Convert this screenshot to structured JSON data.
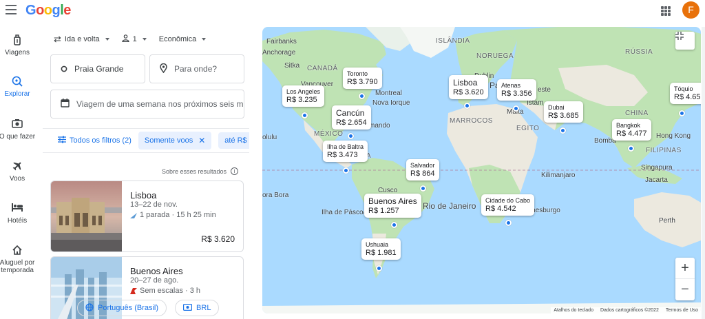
{
  "header": {
    "logo_letters": [
      "G",
      "o",
      "o",
      "g",
      "l",
      "e"
    ],
    "logo_colors": [
      "#4285f4",
      "#ea4335",
      "#fbbc05",
      "#4285f4",
      "#34a853",
      "#ea4335"
    ],
    "avatar_letter": "F"
  },
  "nav": [
    {
      "label": "Viagens",
      "icon": "suitcase-icon"
    },
    {
      "label": "Explorar",
      "icon": "explore-icon",
      "active": true
    },
    {
      "label": "O que fazer",
      "icon": "camera-icon"
    },
    {
      "label": "Voos",
      "icon": "plane-icon"
    },
    {
      "label": "Hotéis",
      "icon": "bed-icon"
    },
    {
      "label": "Aluguel por temporada",
      "icon": "house-icon"
    }
  ],
  "search": {
    "trip_type": "Ida e volta",
    "passengers": "1",
    "cabin": "Econômica",
    "origin": "Praia Grande",
    "destination_placeholder": "Para onde?",
    "dates": "Viagem de uma semana nos próximos seis m..."
  },
  "filters": {
    "all_filters": "Todos os filtros (2)",
    "chip_flights": "Somente voos",
    "chip_price": "até R$"
  },
  "results_note": "Sobre esses resultados",
  "results": [
    {
      "name": "Lisboa",
      "dates": "13–22 de nov.",
      "stops": "1 parada · 15 h 25 min",
      "price": "R$ 3.620"
    },
    {
      "name": "Buenos Aires",
      "dates": "20–27 de ago.",
      "stops": "Sem escalas · 3 h",
      "price": ""
    }
  ],
  "footer": {
    "language": "Português (Brasil)",
    "currency": "BRL"
  },
  "map": {
    "labels": {
      "fairbanks": "Fairbanks",
      "anchorage": "Anchorage",
      "sitka": "Sitka",
      "canada": "CANADÁ",
      "vancouver": "Vancouver",
      "montreal": "Montreal",
      "nova_iorque": "Nova Iorque",
      "mexico": "MÉXICO",
      "olulu": "olulu",
      "islandia": "ISLÂNDIA",
      "noruega": "NORUEGA",
      "russia": "RÚSSIA",
      "marrocos": "MARROCOS",
      "egito": "EGITO",
      "china": "CHINA",
      "hong_kong": "Hong Kong",
      "bombaim": "Bomba",
      "filipinas": "FILIPINAS",
      "singapura": "Singapura",
      "jacarta": "Jacarta",
      "kilimanjaro": "Kilimanjaro",
      "joanesburgo": "Joanesburgo",
      "perth": "Perth",
      "cusco": "Cusco",
      "rio": "Rio de Janeiro",
      "bora_bora": "ora Bora",
      "pascoa": "Ilha de Páscoa",
      "ica": "ICA",
      "mando": "mando",
      "pa": "Pa",
      "malta": "Malta",
      "istam": "Istam",
      "dublin": "Dublin",
      "este": "este"
    },
    "destinations": [
      {
        "name": "Toronto",
        "price": "R$ 3.790"
      },
      {
        "name": "Los Angeles",
        "price": "R$ 3.235"
      },
      {
        "name": "Cancún",
        "price": "R$ 2.654"
      },
      {
        "name": "Ilha de Baltra",
        "price": "R$ 3.473"
      },
      {
        "name": "Lisboa",
        "price": "R$ 3.620"
      },
      {
        "name": "Atenas",
        "price": "R$ 3.356"
      },
      {
        "name": "Dubai",
        "price": "R$ 3.685"
      },
      {
        "name": "Bangkok",
        "price": "R$ 4.477"
      },
      {
        "name": "Tóquio",
        "price": "R$ 4.65"
      },
      {
        "name": "Salvador",
        "price": "R$ 864"
      },
      {
        "name": "Buenos Aires",
        "price": "R$ 1.257"
      },
      {
        "name": "Cidade do Cabo",
        "price": "R$ 4.542"
      },
      {
        "name": "Ushuaia",
        "price": "R$ 1.981"
      }
    ],
    "attribution": {
      "shortcuts": "Atalhos do teclado",
      "data": "Dados cartográficos ©2022",
      "terms": "Termos de Uso"
    },
    "colors": {
      "water": "#aadaff",
      "land": "#bfe3b4",
      "land_dry": "#ece9df",
      "accent": "#1a73e8"
    }
  }
}
